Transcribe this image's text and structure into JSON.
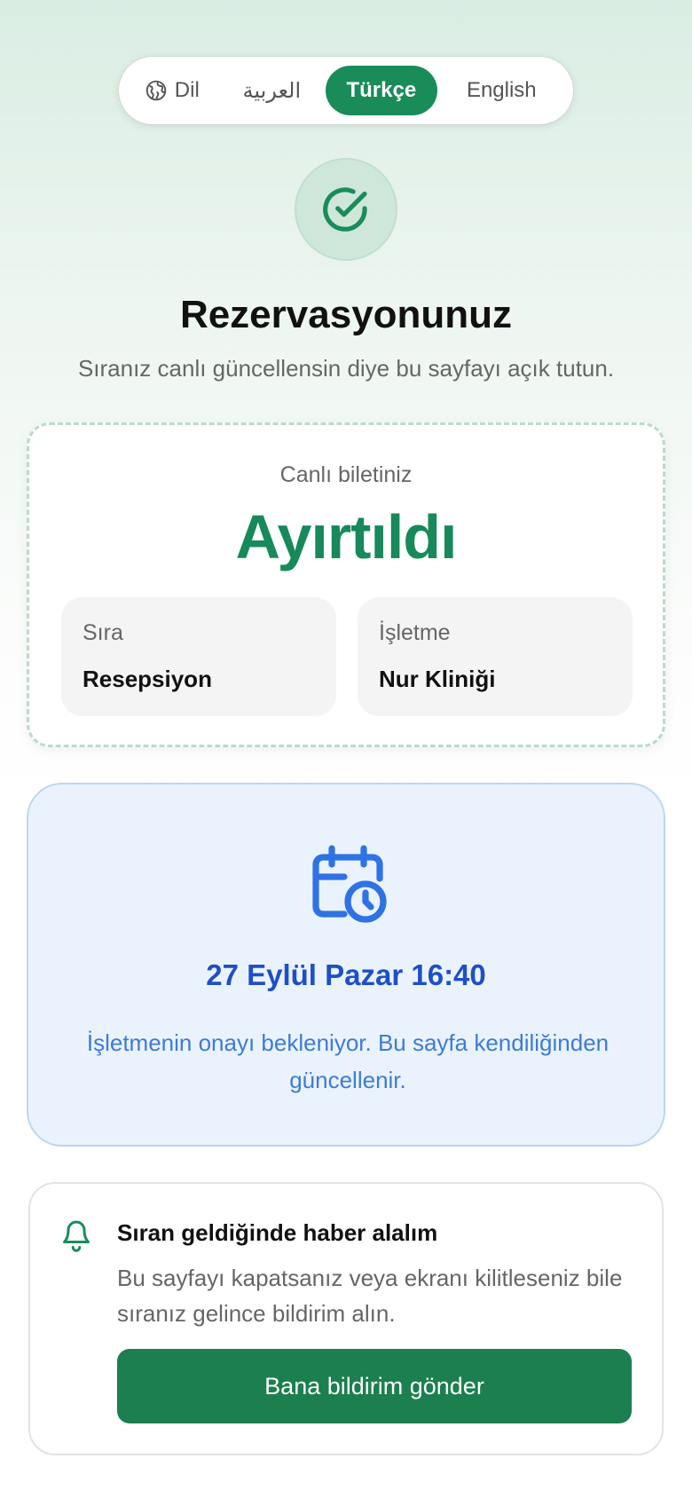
{
  "language_switcher": {
    "label": "Dil",
    "options": [
      "العربية",
      "Türkçe",
      "English"
    ],
    "selected": "Türkçe"
  },
  "header": {
    "title": "Rezervasyonunuz",
    "subtitle": "Sıranız canlı güncellensin diye bu sayfayı açık tutun."
  },
  "ticket": {
    "label": "Canlı biletiniz",
    "status": "Ayırtıldı",
    "queue_label": "Sıra",
    "queue_value": "Resepsiyon",
    "business_label": "İşletme",
    "business_value": "Nur Kliniği"
  },
  "schedule": {
    "datetime": "27 Eylül Pazar 16:40",
    "note": "İşletmenin onayı bekleniyor. Bu sayfa kendiliğinden güncellenir."
  },
  "notification": {
    "title": "Sıran geldiğinde haber alalım",
    "text": "Bu sayfayı kapatsanız veya ekranı kilitleseniz bile sıranız gelince bildirim alın.",
    "button": "Bana bildirim gönder"
  },
  "colors": {
    "primary_green": "#1a8c5a",
    "status_green": "#17895a",
    "schedule_blue": "#1f4fc7",
    "schedule_bg": "#eaf3fd"
  },
  "icons": {
    "language": "globe-icon",
    "badge": "check-circle-icon",
    "schedule": "calendar-clock-icon",
    "notification": "bell-icon"
  }
}
